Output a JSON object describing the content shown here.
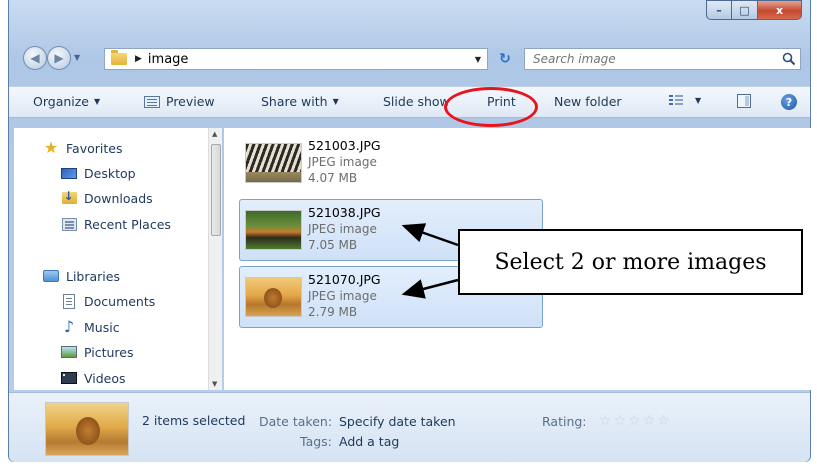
{
  "window": {
    "controls": {
      "minimize": "–",
      "maximize": "□",
      "close": "x"
    }
  },
  "address": {
    "crumb": "image",
    "refresh_glyph": "↻",
    "search_placeholder": "Search image"
  },
  "toolbar": {
    "organize": "Organize",
    "preview": "Preview",
    "share_with": "Share with",
    "slide_show": "Slide show",
    "print": "Print",
    "new_folder": "New folder",
    "help": "?"
  },
  "nav_pane": {
    "items": [
      {
        "label": "Favorites",
        "icon": "star-icon"
      },
      {
        "label": "Desktop",
        "icon": "desktop-icon"
      },
      {
        "label": "Downloads",
        "icon": "downloads-icon"
      },
      {
        "label": "Recent Places",
        "icon": "recent-places-icon"
      },
      {
        "label": "Libraries",
        "icon": "libraries-icon"
      },
      {
        "label": "Documents",
        "icon": "documents-icon"
      },
      {
        "label": "Music",
        "icon": "music-icon"
      },
      {
        "label": "Pictures",
        "icon": "pictures-icon"
      },
      {
        "label": "Videos",
        "icon": "videos-icon"
      }
    ]
  },
  "files": [
    {
      "name": "521003.JPG",
      "type": "JPEG image",
      "size": "4.07 MB",
      "selected": false
    },
    {
      "name": "521038.JPG",
      "type": "JPEG image",
      "size": "7.05 MB",
      "selected": true
    },
    {
      "name": "521070.JPG",
      "type": "JPEG image",
      "size": "2.79 MB",
      "selected": true
    }
  ],
  "callout": {
    "text": "Select 2 or more images"
  },
  "details": {
    "selection_count": "2 items selected",
    "date_taken_label": "Date taken:",
    "date_taken_value": "Specify date taken",
    "tags_label": "Tags:",
    "tags_value": "Add a tag",
    "rating_label": "Rating:",
    "rating_stars": 5
  },
  "colors": {
    "highlight_oval": "#e8141b",
    "selection_bg": "#cfe1f8",
    "accent": "#1e395b"
  }
}
